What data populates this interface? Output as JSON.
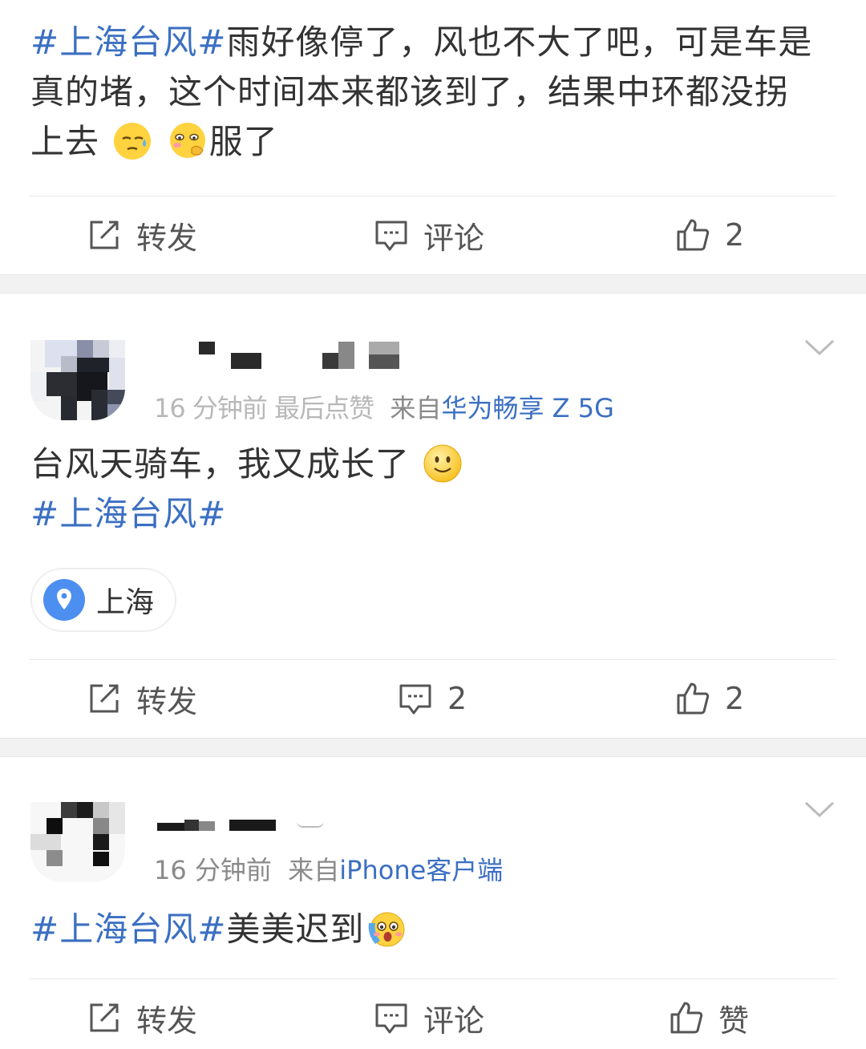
{
  "posts": [
    {
      "topic": "#上海台风#",
      "text_line1": "雨好像停了，风也不大了吧，可是车是",
      "text_line2": "真的堵，这个时间本来都该到了，结果中环都没拐",
      "text_line3a": "上去",
      "text_line3b": "服了",
      "emoji_1": "sweat-face-emoji",
      "emoji_2": "thinking-face-emoji",
      "actions": {
        "share": "转发",
        "comment": "评论",
        "like": "2"
      }
    },
    {
      "time_blurred": "16 分钟前 最后点赞",
      "source_prefix": "来自",
      "source": "华为畅享 Z 5G",
      "text": "台风天骑车，我又成长了",
      "emoji": "smile-emoji",
      "topic": "#上海台风#",
      "location": "上海",
      "actions": {
        "share": "转发",
        "comment": "2",
        "like": "2"
      }
    },
    {
      "time": "16 分钟前",
      "source_prefix": "来自",
      "source": "iPhone客户端",
      "topic": "#上海台风#",
      "text": "美美迟到",
      "emoji": "crying-face-emoji",
      "actions": {
        "share": "转发",
        "comment": "评论",
        "like": "赞"
      }
    }
  ],
  "colors": {
    "topic": "#3b6fc2",
    "text": "#333333",
    "meta": "#8a8a8a",
    "separator": "#f2f2f2"
  }
}
